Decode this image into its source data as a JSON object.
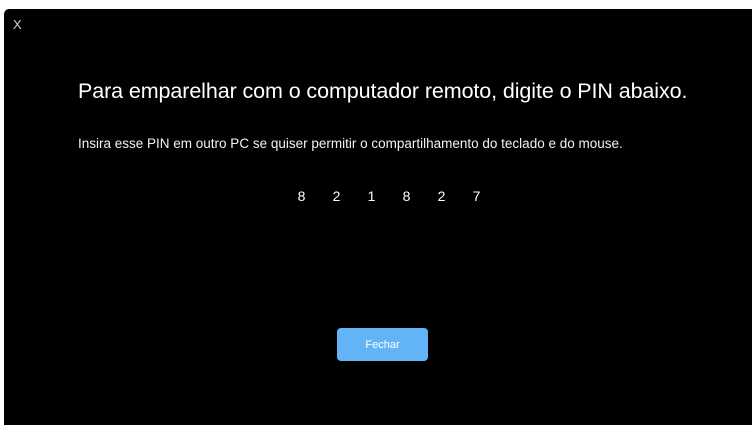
{
  "dialog": {
    "close_glyph": "X",
    "heading": "Para emparelhar com o computador remoto, digite o PIN abaixo.",
    "subtext": "Insira esse PIN em outro PC se quiser permitir o compartilhamento do teclado e do mouse.",
    "pin_digits": [
      "8",
      "2",
      "1",
      "8",
      "2",
      "7"
    ],
    "close_button_label": "Fechar"
  },
  "colors": {
    "background": "#000000",
    "text": "#ffffff",
    "button_accent": "#63b4f6"
  }
}
